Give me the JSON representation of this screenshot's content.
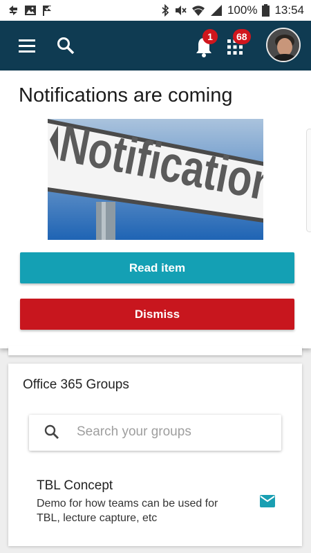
{
  "status_bar": {
    "battery_percent": "100%",
    "time": "13:54",
    "left_icons": [
      "sync-icon",
      "image-icon",
      "check-flag-icon"
    ],
    "right_icons": [
      "bluetooth-icon",
      "mute-icon",
      "wifi-icon",
      "signal-icon",
      "battery-icon"
    ]
  },
  "app_bar": {
    "background": "#0f3b52",
    "icons": [
      "menu-icon",
      "search-icon",
      "bell-icon",
      "apps-grid-icon"
    ],
    "notifications_badge": "1",
    "apps_badge": "68",
    "badge_color": "#d0161d"
  },
  "notification_popup": {
    "title": "Notifications are coming",
    "image_sign_text": "Notification",
    "read_button": "Read item",
    "dismiss_button": "Dismiss",
    "read_color": "#14a0b4",
    "dismiss_color": "#c8161e"
  },
  "groups_card": {
    "title": "Office 365 Groups",
    "search_placeholder": "Search your groups",
    "items": [
      {
        "name": "TBL Concept",
        "description": "Demo for how teams can be used for TBL, lecture capture, etc",
        "icon": "mail-icon"
      }
    ]
  }
}
